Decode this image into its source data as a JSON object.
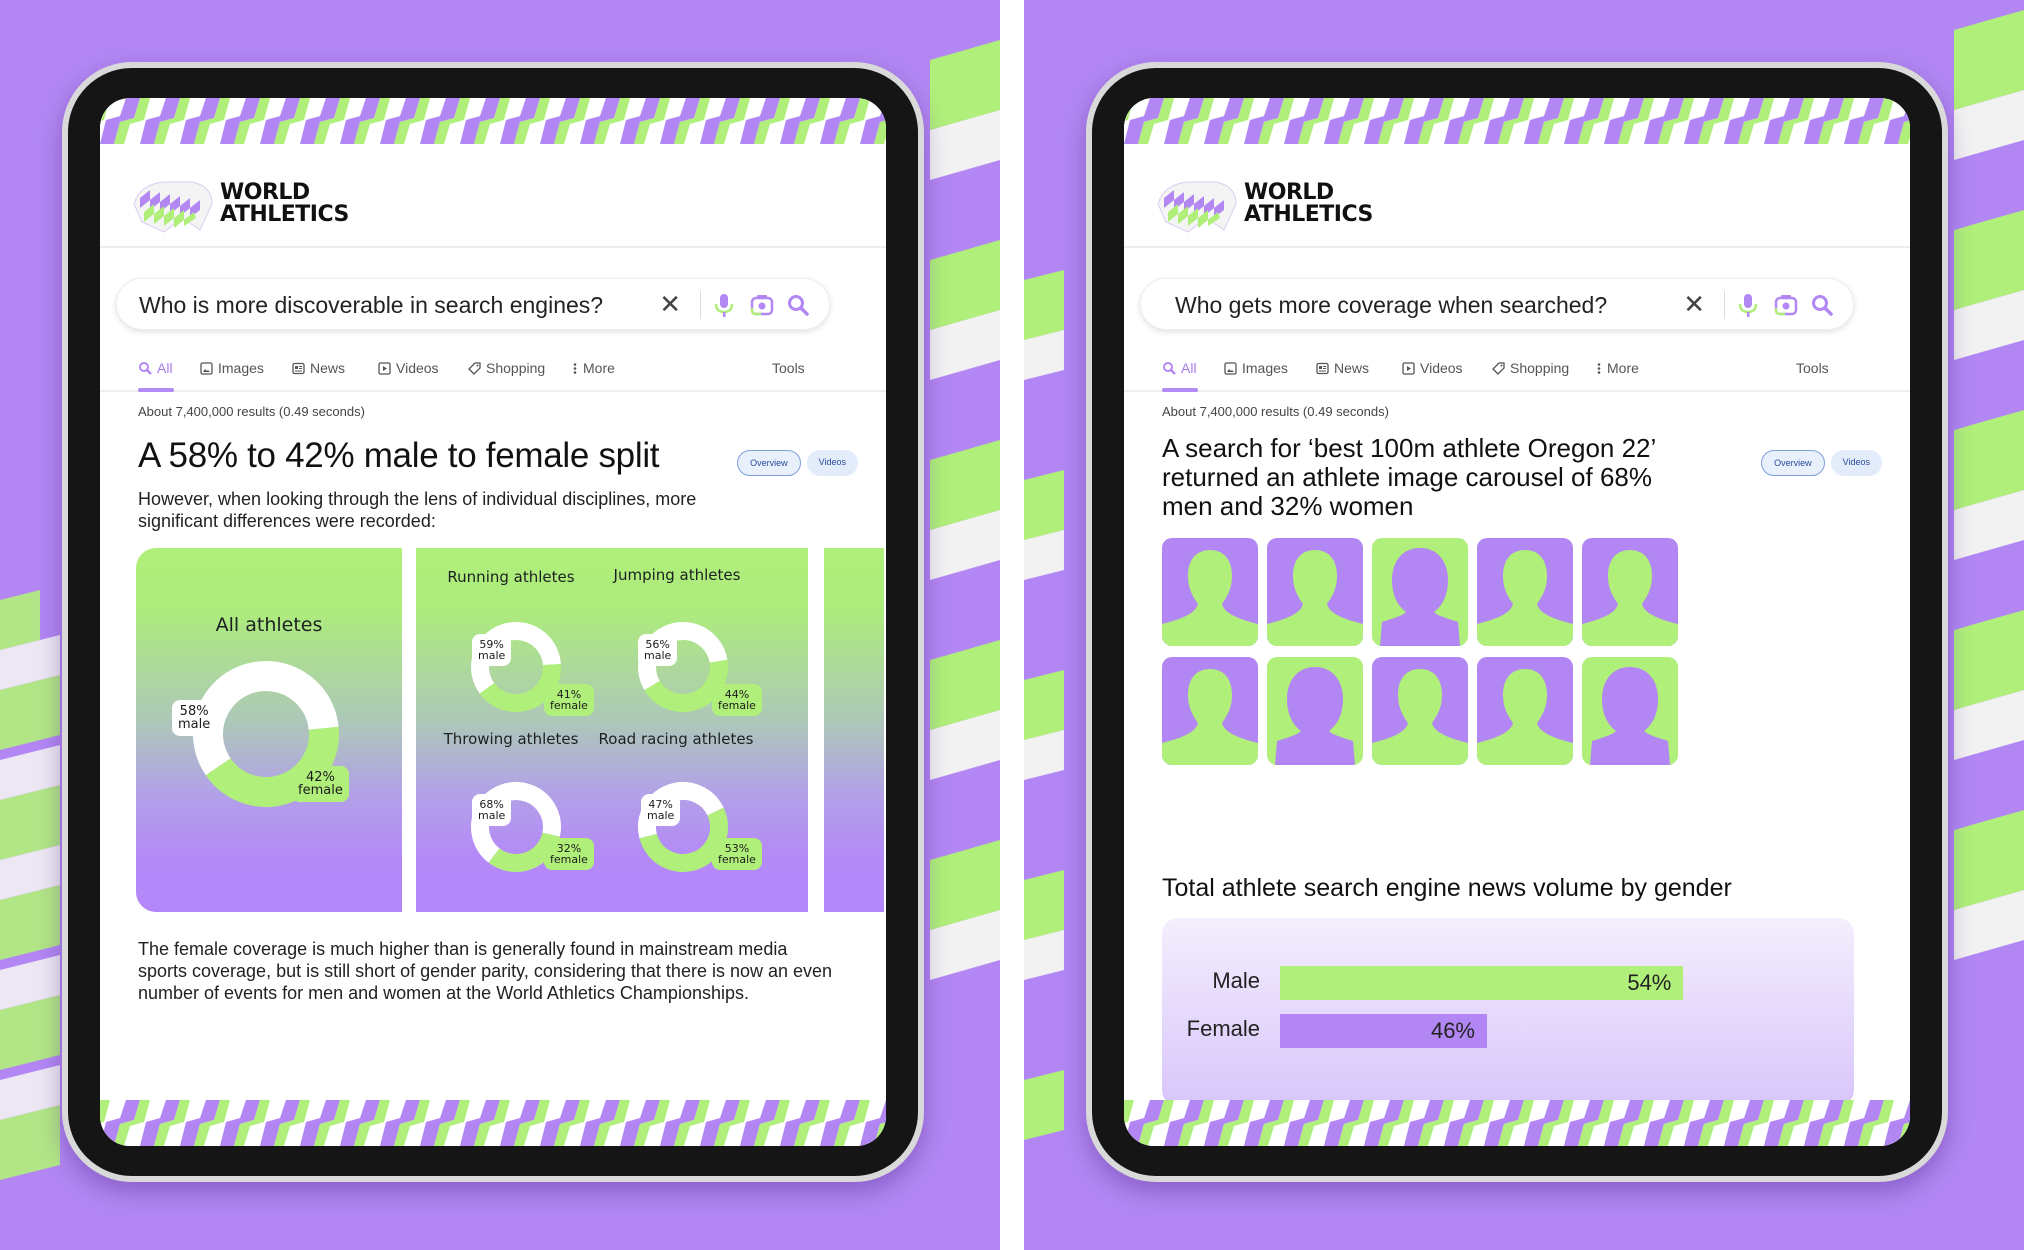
{
  "colors": {
    "purple": "#b287f3",
    "green": "#b0ef7a",
    "white": "#ffffff",
    "accent_tab": "#a67df0",
    "dark": "#151515"
  },
  "brand": {
    "logo_icon": "world-athletics-logo-icon",
    "name_line1": "WORLD",
    "name_line2": "ATHLETICS"
  },
  "left_screen": {
    "search": {
      "query": "Who is more discoverable in search engines?",
      "icons": [
        "close-icon",
        "microphone-icon",
        "camera-icon",
        "search-icon"
      ]
    },
    "tabs": [
      {
        "label": "All",
        "icon": "search-icon",
        "active": true
      },
      {
        "label": "Images",
        "icon": "image-icon",
        "active": false
      },
      {
        "label": "News",
        "icon": "news-icon",
        "active": false
      },
      {
        "label": "Videos",
        "icon": "play-icon",
        "active": false
      },
      {
        "label": "Shopping",
        "icon": "tag-icon",
        "active": false
      },
      {
        "label": "More",
        "icon": "more-vertical-icon",
        "active": false
      }
    ],
    "tools_label": "Tools",
    "result_count": "About 7,400,000 results (0.49 seconds)",
    "chips": [
      "Overview",
      "Videos"
    ],
    "headline": "A 58% to 42% male to female split",
    "subtext": "However, when looking through the lens of individual disciplines, more significant differences were recorded:",
    "body_text": "The female coverage is much higher than is generally found in mainstream media sports coverage, but is still short of gender parity, considering that there is now an even number of events for men and women at the World Athletics Championships."
  },
  "right_screen": {
    "search": {
      "query": "Who gets more coverage when searched?",
      "icons": [
        "close-icon",
        "microphone-icon",
        "camera-icon",
        "search-icon"
      ]
    },
    "tabs": [
      {
        "label": "All",
        "icon": "search-icon",
        "active": true
      },
      {
        "label": "Images",
        "icon": "image-icon",
        "active": false
      },
      {
        "label": "News",
        "icon": "news-icon",
        "active": false
      },
      {
        "label": "Videos",
        "icon": "play-icon",
        "active": false
      },
      {
        "label": "Shopping",
        "icon": "tag-icon",
        "active": false
      },
      {
        "label": "More",
        "icon": "more-vertical-icon",
        "active": false
      }
    ],
    "tools_label": "Tools",
    "result_count": "About 7,400,000 results (0.49 seconds)",
    "chips": [
      "Overview",
      "Videos"
    ],
    "headline": "A search for ‘best 100m athlete Oregon 22’ returned an athlete image carousel of 68% men and 32% women",
    "avatar_grid": [
      "male",
      "male",
      "female",
      "male",
      "male",
      "male",
      "female",
      "male",
      "male",
      "female"
    ],
    "bar_chart_title": "Total athlete search engine news volume by gender"
  },
  "chart_data": [
    {
      "type": "pie",
      "title": "All athletes",
      "categories": [
        "male",
        "female"
      ],
      "values": [
        58,
        42
      ],
      "labels": [
        "58%\nmale",
        "42%\nfemale"
      ]
    },
    {
      "type": "pie",
      "title": "Running athletes",
      "categories": [
        "male",
        "female"
      ],
      "values": [
        59,
        41
      ],
      "labels": [
        "59%\nmale",
        "41%\nfemale"
      ]
    },
    {
      "type": "pie",
      "title": "Jumping athletes",
      "categories": [
        "male",
        "female"
      ],
      "values": [
        56,
        44
      ],
      "labels": [
        "56%\nmale",
        "44%\nfemale"
      ]
    },
    {
      "type": "pie",
      "title": "Throwing athletes",
      "categories": [
        "male",
        "female"
      ],
      "values": [
        68,
        32
      ],
      "labels": [
        "68%\nmale",
        "32%\nfemale"
      ]
    },
    {
      "type": "pie",
      "title": "Road racing athletes",
      "categories": [
        "male",
        "female"
      ],
      "values": [
        47,
        53
      ],
      "labels": [
        "47%\nmale",
        "53%\nfemale"
      ]
    },
    {
      "type": "bar",
      "title": "Total athlete search engine news volume by gender",
      "orientation": "horizontal",
      "categories": [
        "Male",
        "Female"
      ],
      "values": [
        54,
        46
      ],
      "value_labels": [
        "54%",
        "46%"
      ],
      "xlim": [
        0,
        100
      ]
    }
  ]
}
